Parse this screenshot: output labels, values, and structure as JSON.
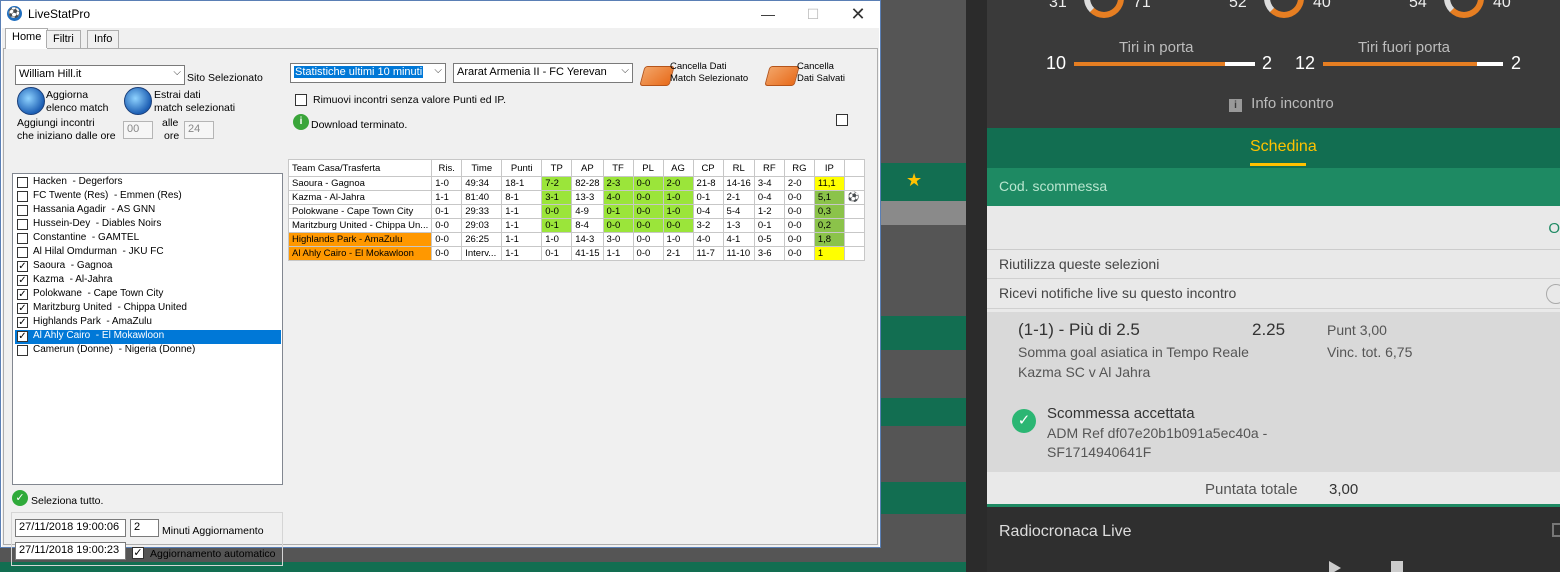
{
  "window": {
    "title": "LiveStatPro",
    "tabs": [
      "Home",
      "Filtri",
      "Info"
    ]
  },
  "left_panel": {
    "bookmaker_select": "William Hill.it",
    "site_label": "Sito Selezionato",
    "update_list_label_1": "Aggiorna",
    "update_list_label_2": "elenco match",
    "extract_label_1": "Estrai dati",
    "extract_label_2": "match selezionati",
    "add_matches_label_1": "Aggiungi incontri",
    "add_matches_label_2": "che iniziano dalle ore",
    "from_hour": "00",
    "to_label_1": "alle",
    "to_label_2": "ore",
    "to_hour": "24",
    "matches": [
      {
        "name": "Hacken  - Degerfors",
        "checked": false
      },
      {
        "name": "FC Twente (Res)  - Emmen (Res)",
        "checked": false
      },
      {
        "name": "Hassania Agadir  - AS GNN",
        "checked": false
      },
      {
        "name": "Hussein-Dey  - Diables Noirs",
        "checked": false
      },
      {
        "name": "Constantine  - GAMTEL",
        "checked": false
      },
      {
        "name": "Al Hilal Omdurman  - JKU FC",
        "checked": false
      },
      {
        "name": "Saoura  - Gagnoa",
        "checked": true
      },
      {
        "name": "Kazma  - Al-Jahra",
        "checked": true
      },
      {
        "name": "Polokwane  - Cape Town City",
        "checked": true
      },
      {
        "name": "Maritzburg United  - Chippa United",
        "checked": true
      },
      {
        "name": "Highlands Park  - AmaZulu",
        "checked": true
      },
      {
        "name": "Al Ahly Cairo  - El Mokawloon",
        "checked": true,
        "selected": true
      },
      {
        "name": "Camerun (Donne)  - Nigeria (Donne)",
        "checked": false
      }
    ],
    "select_all": "Seleziona tutto.",
    "timestamp_1": "27/11/2018 19:00:06",
    "minutes_value": "2",
    "minutes_label": "Minuti Aggiornamento",
    "timestamp_2": "27/11/2018 19:00:23",
    "auto_update_label": "Aggiornamento automatico",
    "auto_update_checked": "✓"
  },
  "right_panel": {
    "stats_select": "Statistiche ultimi 10 minuti",
    "match_select": "Ararat Armenia II - FC Yerevan",
    "clear_match_1": "Cancella Dati",
    "clear_match_2": "Match Selezionato",
    "clear_saved_1": "Cancella",
    "clear_saved_2": "Dati Salvati",
    "remove_no_value": "Rimuovi incontri senza valore Punti ed IP.",
    "download_status": "Download terminato.",
    "grid_headers": [
      "Team Casa/Trasferta",
      "Ris.",
      "Time",
      "Punti",
      "TP",
      "AP",
      "TF",
      "PL",
      "AG",
      "CP",
      "RL",
      "RF",
      "RG",
      "IP",
      ""
    ],
    "grid_rows": [
      [
        "Saoura - Gagnoa",
        "1-0",
        "49:34",
        "18-1",
        "7-2",
        "82-28",
        "2-3",
        "0-0",
        "2-0",
        "21-8",
        "14-16",
        "3-4",
        "2-0",
        "11,1",
        ""
      ],
      [
        "Kazma - Al-Jahra",
        "1-1",
        "81:40",
        "8-1",
        "3-1",
        "13-3",
        "4-0",
        "0-0",
        "1-0",
        "0-1",
        "2-1",
        "0-4",
        "0-0",
        "5,1",
        "⚽"
      ],
      [
        "Polokwane - Cape Town City",
        "0-1",
        "29:33",
        "1-1",
        "0-0",
        "4-9",
        "0-1",
        "0-0",
        "1-0",
        "0-4",
        "5-4",
        "1-2",
        "0-0",
        "0,3",
        ""
      ],
      [
        "Maritzburg United - Chippa Un...",
        "0-0",
        "29:03",
        "1-1",
        "0-1",
        "8-4",
        "0-0",
        "0-0",
        "0-0",
        "3-2",
        "1-3",
        "0-1",
        "0-0",
        "0,2",
        ""
      ],
      [
        "Highlands Park - AmaZulu",
        "0-0",
        "26:25",
        "1-1",
        "1-0",
        "14-3",
        "3-0",
        "0-0",
        "1-0",
        "4-0",
        "4-1",
        "0-5",
        "0-0",
        "1,8",
        ""
      ],
      [
        "Al Ahly Cairo - El Mokawloon",
        "0-0",
        "Interv...",
        "1-1",
        "0-1",
        "41-15",
        "1-1",
        "0-0",
        "2-1",
        "11-7",
        "11-10",
        "3-6",
        "0-0",
        "1",
        ""
      ]
    ]
  },
  "betting": {
    "donut_values": [
      "31",
      "71",
      "52",
      "40",
      "54",
      "40"
    ],
    "shots_on_title": "Tiri in porta",
    "shots_on_home": "10",
    "shots_on_away": "2",
    "shots_off_title": "Tiri fuori porta",
    "shots_off_home": "12",
    "shots_off_away": "2",
    "info_label": "Info incontro",
    "schedina": "Schedina",
    "cod_label": "Cod. scommessa",
    "o_label": "O",
    "reuse_label": "Riutilizza queste selezioni",
    "notify_label": "Ricevi notifiche live su questo incontro",
    "bet_title": "(1-1) - Più di 2.5",
    "bet_odds": "2.25",
    "bet_punt": "Punt  3,00",
    "bet_market": "Somma goal asiatica in Tempo Reale",
    "bet_vinc": "Vinc. tot.     6,75",
    "bet_match": "Kazma SC v Al Jahra",
    "accepted": "Scommessa accettata",
    "ref_1": "ADM Ref df07e20b1b091a5ec40a -",
    "ref_2": "SF1714940641F",
    "total_label": "Puntata totale",
    "total_value": "3,00",
    "radio_label": "Radiocronaca Live"
  }
}
